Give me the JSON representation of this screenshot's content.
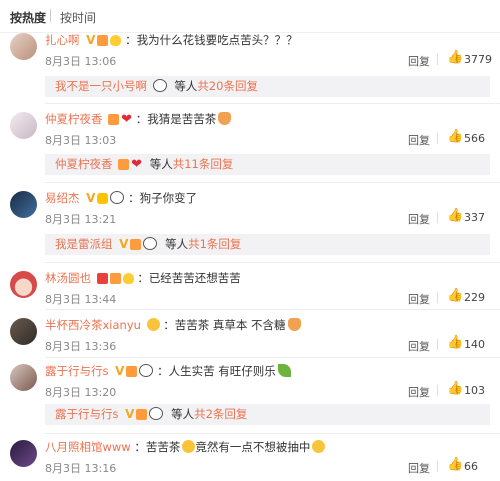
{
  "sort": {
    "hot": "按热度",
    "time": "按时间"
  },
  "reply_label": "回复",
  "comments": [
    {
      "username": "扎心啊",
      "sep": "：",
      "text": "我为什么花钱要吃点苦头？？？",
      "time": "8月3日 13:06",
      "likes": "3779",
      "sub": {
        "name": "我不是一只小号啊",
        "mid": "等人",
        "link": "共20条回复"
      }
    },
    {
      "username": "仲夏柠夜香",
      "sep": "：",
      "text": "我猜是苦苦茶",
      "time": "8月3日 13:03",
      "likes": "566",
      "sub": {
        "name": "仲夏柠夜香",
        "mid": "等人",
        "link": "共11条回复"
      }
    },
    {
      "username": "易绍杰",
      "sep": "：",
      "text": "狗子你变了",
      "time": "8月3日 13:21",
      "likes": "337",
      "sub": {
        "name": "我是雷派组",
        "mid": "等人",
        "link": "共1条回复"
      }
    },
    {
      "username": "林汤圆也",
      "sep": "：",
      "text": "已经苦苦还想苦苦",
      "time": "8月3日 13:44",
      "likes": "229"
    },
    {
      "username": "半杯西冷茶xianyu",
      "sep": "：",
      "text": "苦苦茶 真草本 不含糖",
      "time": "8月3日 13:36",
      "likes": "140"
    },
    {
      "username": "露于行与行s",
      "sep": "：",
      "text": "人生实苦 有旺仔则乐",
      "time": "8月3日 13:20",
      "likes": "103",
      "sub": {
        "name": "露于行与行s",
        "mid": "等人",
        "link": "共2条回复"
      }
    },
    {
      "username": "八月照相馆www",
      "sep": "：",
      "text": "苦苦茶",
      "text2": "竟然有一点不想被抽中",
      "time": "8月3日 13:16",
      "likes": "66"
    }
  ],
  "colors": {
    "accent": "#eb7350",
    "muted": "#888888",
    "subbox_bg": "#f2f2f5"
  },
  "icons": [
    "thumbs-up-icon",
    "vip-badge-icon",
    "panda-emoji-icon",
    "heart-icon",
    "cat-emoji-icon",
    "laugh-emoji-icon",
    "leaf-emoji-icon"
  ]
}
